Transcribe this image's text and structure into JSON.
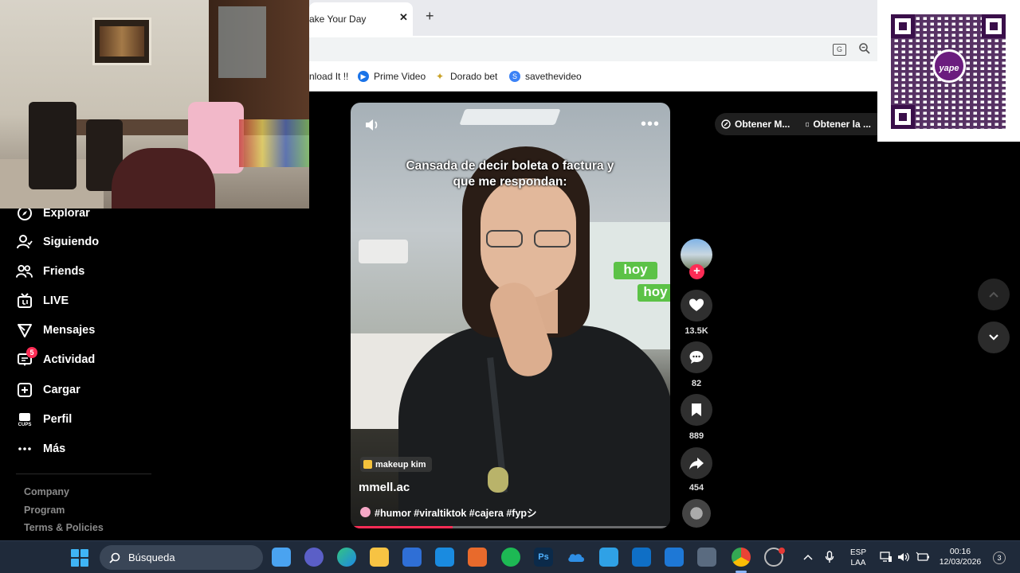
{
  "browser": {
    "tab_title": "ake Your Day",
    "tab_close": "✕",
    "new_tab": "+",
    "bookmarks": [
      {
        "label": "nload It !!",
        "icon": "bookmark-icon"
      },
      {
        "label": "Prime Video",
        "icon": "play-circle-icon",
        "color": "#1a73e8"
      },
      {
        "label": "Dorado bet",
        "icon": "star-icon",
        "color": "#c9a227"
      },
      {
        "label": "savethevideo",
        "icon": "s-letter-icon",
        "color": "#3b82f6"
      }
    ],
    "translate_glyph": "G"
  },
  "qr": {
    "logo_text": "yape"
  },
  "sidebar": {
    "items": [
      {
        "label": "Explorar",
        "icon": "compass-icon"
      },
      {
        "label": "Siguiendo",
        "icon": "following-icon"
      },
      {
        "label": "Friends",
        "icon": "friends-icon"
      },
      {
        "label": "LIVE",
        "icon": "live-tv-icon"
      },
      {
        "label": "Mensajes",
        "icon": "send-icon"
      },
      {
        "label": "Actividad",
        "icon": "activity-icon",
        "badge": "5"
      },
      {
        "label": "Cargar",
        "icon": "upload-plus-icon"
      },
      {
        "label": "Perfil",
        "icon": "profile-icon",
        "icon_text": "CUPS"
      },
      {
        "label": "Más",
        "icon": "more-dots-icon"
      }
    ],
    "footer": [
      "Company",
      "Program",
      "Terms & Policies"
    ]
  },
  "video": {
    "caption_line1": "Cansada de decir boleta o factura y",
    "caption_line2": "que me respondan:",
    "scene_sign": "hoy",
    "sound_label": "makeup kim",
    "author": "mmell.ac",
    "hashtags": "#humor #viraltiktok #cajera #fypシ",
    "progress": 0.32
  },
  "actions": {
    "likes": "13.5K",
    "comments": "82",
    "saves": "889",
    "shares": "454",
    "follow_symbol": "+"
  },
  "top_buttons": {
    "get_app_1": "Obtener M...",
    "get_app_2": "Obtener la ..."
  },
  "taskbar": {
    "search_label": "Búsqueda",
    "lang_top": "ESP",
    "lang_bottom": "LAA",
    "time": "00:16",
    "date": "12/03/2026",
    "notifications": "3",
    "photoshop_label": "Ps"
  },
  "colors": {
    "accent": "#fe2c55",
    "taskbar": "#1f2a3a",
    "yape_purple": "#6b1d7e"
  }
}
